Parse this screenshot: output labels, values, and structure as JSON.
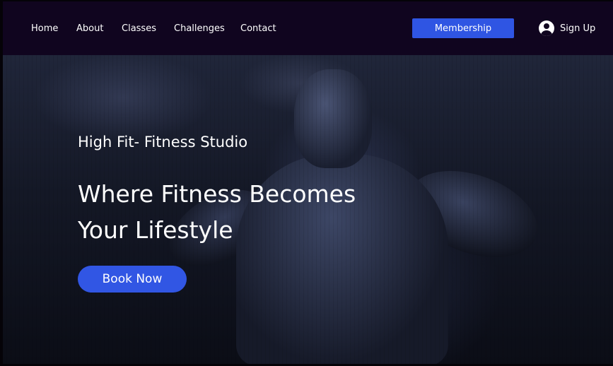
{
  "nav": {
    "links": [
      {
        "label": "Home"
      },
      {
        "label": "About"
      },
      {
        "label": "Classes"
      },
      {
        "label": "Challenges"
      },
      {
        "label": "Contact"
      }
    ],
    "membership_label": "Membership",
    "signup_label": "Sign Up"
  },
  "hero": {
    "subtitle": "High Fit- Fitness Studio",
    "headline": "Where Fitness Becomes Your Lifestyle",
    "cta_label": "Book Now"
  },
  "colors": {
    "nav_bg": "#10051f",
    "accent": "#2f55e3",
    "text": "#ffffff"
  },
  "icons": {
    "signup": "user-avatar-icon"
  }
}
